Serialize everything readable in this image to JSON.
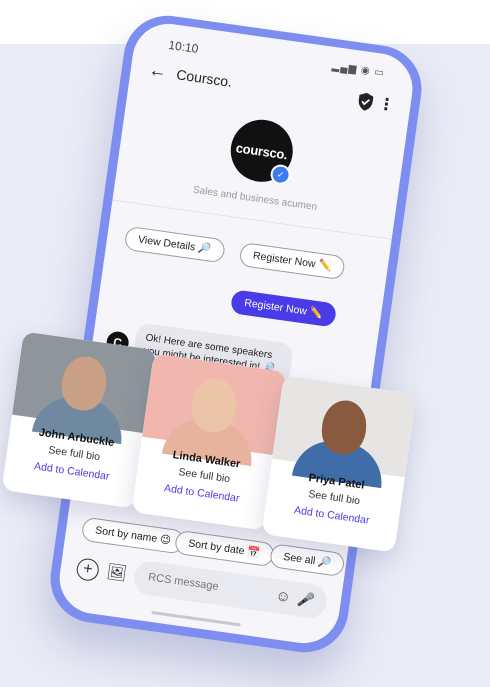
{
  "status": {
    "time": "10:10",
    "icons": "▂▄▆ ◉ ▭"
  },
  "appbar": {
    "back_icon": "←",
    "title": "Coursco.",
    "menu_icon": "⋮"
  },
  "profile": {
    "logo_text": "coursco.",
    "tagline": "Sales and business acumen"
  },
  "chips_top": {
    "view_details": "View Details 🔎",
    "register_now": "Register Now ✏️"
  },
  "sent": {
    "register_now": "Register Now ✏️"
  },
  "bot": {
    "avatar": "C",
    "message": "Ok! Here are some speakers you might be interested in! 🔎😉"
  },
  "speakers": [
    {
      "name": "John Arbuckle",
      "bio": "See full bio",
      "action": "Add to Calendar"
    },
    {
      "name": "Linda Walker",
      "bio": "See full bio",
      "action": "Add to Calendar"
    },
    {
      "name": "Priya Patel",
      "bio": "See full bio",
      "action": "Add to Calendar"
    }
  ],
  "chips_bottom": {
    "sort_name": "Sort by name 😉",
    "sort_date": "Sort by date 📅",
    "see_all": "See all 🔎"
  },
  "compose": {
    "placeholder": "RCS message",
    "plus_icon": "+",
    "gallery_icon": "🖼",
    "emoji_icon": "☺",
    "mic_icon": "🎤"
  },
  "colors": {
    "accent": "#4a3be8",
    "frame": "#7d8ef0",
    "background": "#e9ebf6"
  }
}
